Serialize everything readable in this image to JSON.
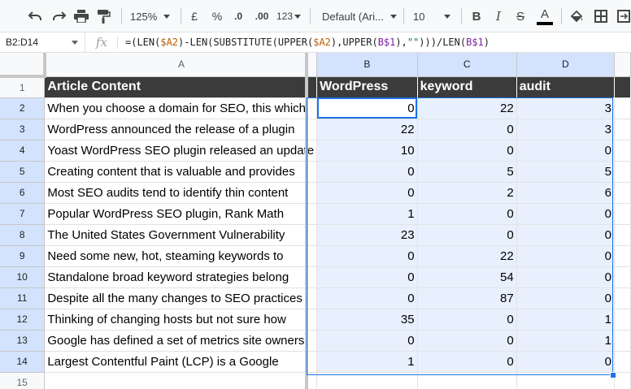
{
  "toolbar": {
    "zoom": "125%",
    "currency": "£",
    "percent": "%",
    "dec_decrease": ".0",
    "dec_increase": ".00",
    "more_formats": "123",
    "font": "Default (Ari...",
    "font_size": "10",
    "bold": "B",
    "italic": "I",
    "strikethrough": "S",
    "text_color": "A",
    "text_color_hex": "#000000"
  },
  "formula_bar": {
    "name_box": "B2:D14",
    "fx": "fx",
    "formula_parts": [
      "=(LEN(",
      "$A2",
      ")-LEN(SUBSTITUTE(UPPER(",
      "$A2",
      "),UPPER(",
      "B$1",
      "),",
      "\"\"",
      ")))/LEN(",
      "B$1",
      ")"
    ]
  },
  "columns": [
    "A",
    "B",
    "C",
    "D"
  ],
  "header_row": {
    "row_number": "1",
    "a": "Article Content",
    "b": "WordPress",
    "c": "keyword",
    "d": "audit"
  },
  "rows": [
    {
      "n": "2",
      "a": "When you choose a domain for SEO, this which",
      "b": "0",
      "c": "22",
      "d": "3"
    },
    {
      "n": "3",
      "a": "WordPress announced the release of a plugin",
      "b": "22",
      "c": "0",
      "d": "3"
    },
    {
      "n": "4",
      "a": "Yoast WordPress SEO plugin released an update",
      "b": "10",
      "c": "0",
      "d": "0"
    },
    {
      "n": "5",
      "a": "Creating content that is valuable and provides",
      "b": "0",
      "c": "5",
      "d": "5"
    },
    {
      "n": "6",
      "a": "Most SEO audits tend to identify thin content",
      "b": "0",
      "c": "2",
      "d": "6"
    },
    {
      "n": "7",
      "a": "Popular WordPress SEO plugin, Rank Math",
      "b": "1",
      "c": "0",
      "d": "0"
    },
    {
      "n": "8",
      "a": "The United States Government Vulnerability",
      "b": "23",
      "c": "0",
      "d": "0"
    },
    {
      "n": "9",
      "a": "Need some new, hot, steaming keywords to",
      "b": "0",
      "c": "22",
      "d": "0"
    },
    {
      "n": "10",
      "a": "Standalone broad keyword strategies belong",
      "b": "0",
      "c": "54",
      "d": "0"
    },
    {
      "n": "11",
      "a": "Despite all the many changes to SEO practices",
      "b": "0",
      "c": "87",
      "d": "0"
    },
    {
      "n": "12",
      "a": "Thinking of changing hosts but not sure how",
      "b": "35",
      "c": "0",
      "d": "1"
    },
    {
      "n": "13",
      "a": "Google has defined a set of metrics site owners",
      "b": "0",
      "c": "0",
      "d": "1"
    },
    {
      "n": "14",
      "a": "Largest Contentful Paint (LCP) is a Google",
      "b": "1",
      "c": "0",
      "d": "0"
    }
  ],
  "next_row_number": "15",
  "colors": {
    "header_bg": "#3b3b3b",
    "selection_bg": "#e8f0fe",
    "selection_border": "#1a73e8"
  }
}
